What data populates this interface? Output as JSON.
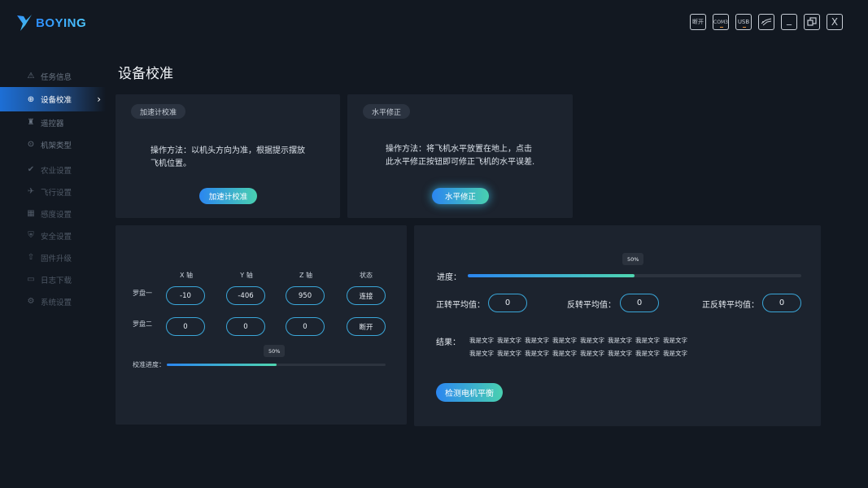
{
  "app": {
    "logo_text": "BOYING"
  },
  "window_controls": {
    "disconnect": "断开",
    "com": "COM3",
    "usb": "USB",
    "minimize": "_",
    "close": "X"
  },
  "sidebar": {
    "items": [
      {
        "label": "任务信息",
        "icon": "warning-icon"
      },
      {
        "label": "设备校准",
        "icon": "calibrate-icon"
      },
      {
        "label": "遥控器",
        "icon": "remote-icon"
      },
      {
        "label": "机架类型",
        "icon": "frame-icon"
      },
      {
        "label": "农业设置",
        "icon": "agri-icon"
      },
      {
        "label": "飞行设置",
        "icon": "flight-icon"
      },
      {
        "label": "感度设置",
        "icon": "sensitivity-icon"
      },
      {
        "label": "安全设置",
        "icon": "shield-icon"
      },
      {
        "label": "固件升级",
        "icon": "upgrade-icon"
      },
      {
        "label": "日志下载",
        "icon": "log-icon"
      },
      {
        "label": "系统设置",
        "icon": "gear-icon"
      }
    ],
    "active_index": 1
  },
  "page": {
    "title": "设备校准"
  },
  "accel_card": {
    "tag": "加速计校准",
    "desc_line1": "操作方法：以机头方向为准，根据提示摆放",
    "desc_line2": "飞机位置。",
    "button": "加速计校准"
  },
  "level_card": {
    "tag": "水平修正",
    "desc_line1": "操作方法：将飞机水平放置在地上，点击",
    "desc_line2": "此水平修正按钮即可修正飞机的水平误差.",
    "button": "水平修正"
  },
  "compass_card": {
    "headers": [
      "X 轴",
      "Y 轴",
      "Z 轴",
      "状态"
    ],
    "rows": [
      {
        "label": "罗盘一",
        "x": "-10",
        "y": "-406",
        "z": "950",
        "status": "连接"
      },
      {
        "label": "罗盘二",
        "x": "0",
        "y": "0",
        "z": "0",
        "status": "断开"
      }
    ],
    "progress_label": "校准进度：",
    "progress_text": "50%",
    "progress_value": 0.5
  },
  "motor_card": {
    "progress_label": "进度：",
    "progress_text": "50%",
    "progress_value": 0.5,
    "fwd_label": "正转平均值：",
    "fwd_value": "0",
    "rev_label": "反转平均值：",
    "rev_value": "0",
    "both_label": "正反转平均值：",
    "both_value": "0",
    "result_label": "结果：",
    "result_words_row1": [
      "我是文字",
      "我是文字",
      "我是文字",
      "我是文字",
      "我是文字",
      "我是文字",
      "我是文字",
      "我是文字"
    ],
    "result_words_row2": [
      "我是文字",
      "我是文字",
      "我是文字",
      "我是文字",
      "我是文字",
      "我是文字",
      "我是文字",
      "我是文字"
    ],
    "button": "检测电机平衡"
  },
  "colors": {
    "accent": "#2b86f0",
    "accent2": "#4fd6b0",
    "pill_border": "#3aa6d8"
  }
}
